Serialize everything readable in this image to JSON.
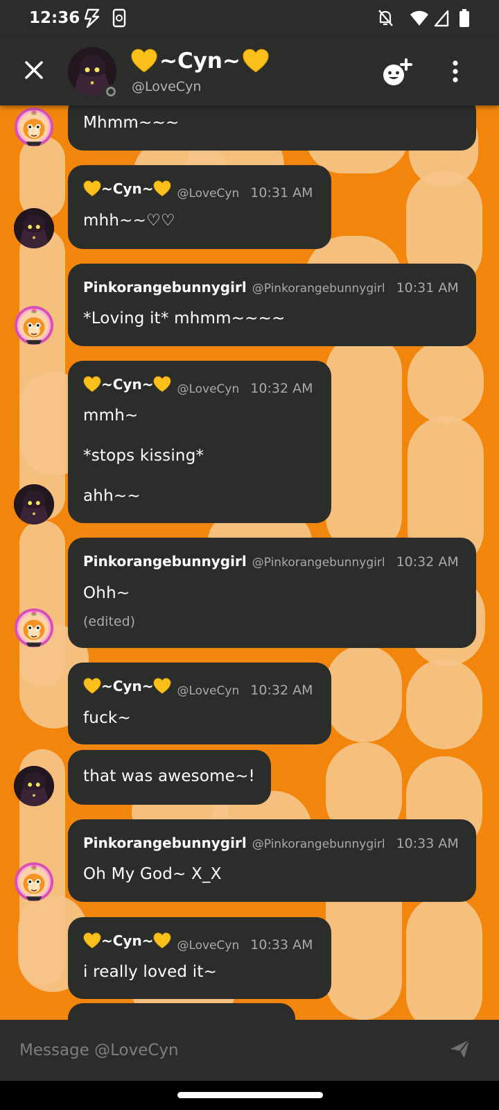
{
  "status_bar": {
    "time": "12:36"
  },
  "header": {
    "title": "~Cyn~",
    "subtitle": "@LoveCyn"
  },
  "messages": [
    {
      "text": "Mhmm~~~"
    },
    {
      "name": "~Cyn~",
      "handle": "@LoveCyn",
      "time": "10:31 AM",
      "text": "mhh~~♡♡"
    },
    {
      "name": "Pinkorangebunnygirl",
      "handle": "@Pinkorangebunnygirl",
      "time": "10:31 AM",
      "text": "*Loving it* mhmm~~~~"
    },
    {
      "name": "~Cyn~",
      "handle": "@LoveCyn",
      "time": "10:32 AM",
      "lines": [
        "mmh~",
        "*stops kissing*",
        "ahh~~"
      ]
    },
    {
      "name": "Pinkorangebunnygirl",
      "handle": "@Pinkorangebunnygirl",
      "time": "10:32 AM",
      "text": "Ohh~",
      "edited": "(edited)"
    },
    {
      "name": "~Cyn~",
      "handle": "@LoveCyn",
      "time": "10:32 AM",
      "text": "fuck~"
    },
    {
      "text": "that was awesome~!"
    },
    {
      "name": "Pinkorangebunnygirl",
      "handle": "@Pinkorangebunnygirl",
      "time": "10:33 AM",
      "text": "Oh My God~ X_X"
    },
    {
      "name": "~Cyn~",
      "handle": "@LoveCyn",
      "time": "10:33 AM",
      "text": "i really loved it~"
    }
  ],
  "composer": {
    "placeholder": "Message @LoveCyn"
  },
  "colors": {
    "background": "#f2860c",
    "bubble": "#2b2d2b",
    "bar": "#2b2d2a",
    "heart": "#fbc01b"
  }
}
